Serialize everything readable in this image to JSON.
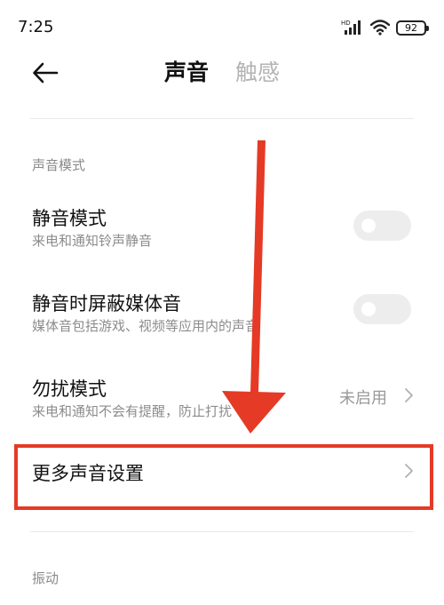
{
  "status_bar": {
    "time": "7:25",
    "network_label": "HD",
    "battery_level": "92"
  },
  "header": {
    "back_icon": "back-arrow-icon",
    "tabs": [
      {
        "label": "声音",
        "active": true
      },
      {
        "label": "触感",
        "active": false
      }
    ]
  },
  "sections": {
    "sound_mode_label": "声音模式",
    "vibration_label": "振动"
  },
  "settings": {
    "silent_mode": {
      "title": "静音模式",
      "subtitle": "来电和通知铃声静音",
      "enabled": false
    },
    "mute_media": {
      "title": "静音时屏蔽媒体音",
      "subtitle": "媒体音包括游戏、视频等应用内的声音",
      "enabled": false
    },
    "dnd": {
      "title": "勿扰模式",
      "subtitle": "来电和通知不会有提醒，防止打扰",
      "value": "未启用"
    },
    "more_sound": {
      "title": "更多声音设置"
    }
  },
  "annotation": {
    "color": "#e53a26"
  }
}
